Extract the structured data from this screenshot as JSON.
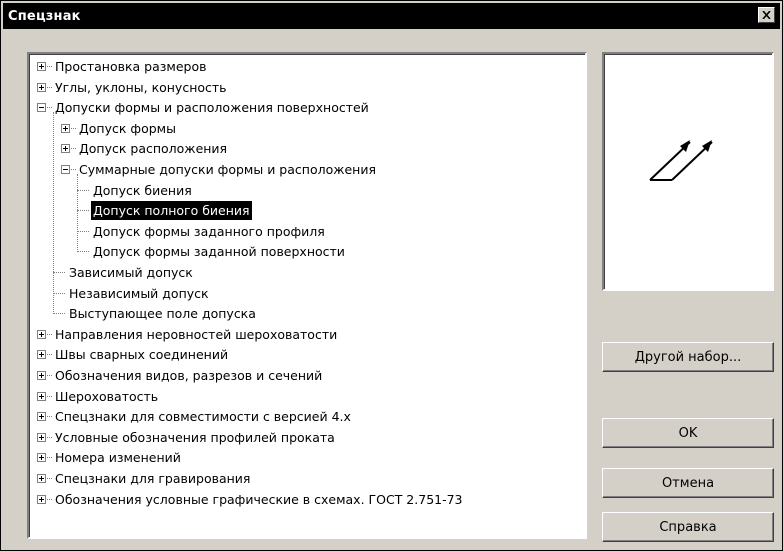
{
  "window": {
    "title": "Спецзнак",
    "close_icon": "close-icon"
  },
  "tree": {
    "items": [
      {
        "label": "Простановка размеров",
        "level": 0,
        "expander": "plus",
        "selected": false
      },
      {
        "label": "Углы, уклоны, конусность",
        "level": 0,
        "expander": "plus",
        "selected": false
      },
      {
        "label": "Допуски формы и расположения поверхностей",
        "level": 0,
        "expander": "minus",
        "selected": false
      },
      {
        "label": "Допуск формы",
        "level": 1,
        "expander": "plus",
        "selected": false
      },
      {
        "label": "Допуск расположения",
        "level": 1,
        "expander": "plus",
        "selected": false
      },
      {
        "label": "Суммарные допуски формы и расположения",
        "level": 1,
        "expander": "minus",
        "selected": false
      },
      {
        "label": "Допуск биения",
        "level": 2,
        "expander": "none",
        "selected": false
      },
      {
        "label": "Допуск полного биения",
        "level": 2,
        "expander": "none",
        "selected": true
      },
      {
        "label": "Допуск формы заданного профиля",
        "level": 2,
        "expander": "none",
        "selected": false
      },
      {
        "label": "Допуск формы заданной поверхности",
        "level": 2,
        "expander": "none",
        "selected": false
      },
      {
        "label": "Зависимый допуск",
        "level": 1,
        "expander": "none",
        "selected": false
      },
      {
        "label": "Независимый допуск",
        "level": 1,
        "expander": "none",
        "selected": false
      },
      {
        "label": "Выступающее поле допуска",
        "level": 1,
        "expander": "none",
        "selected": false
      },
      {
        "label": "Направления неровностей шероховатости",
        "level": 0,
        "expander": "plus",
        "selected": false
      },
      {
        "label": "Швы сварных соединений",
        "level": 0,
        "expander": "plus",
        "selected": false
      },
      {
        "label": "Обозначения видов, разрезов и сечений",
        "level": 0,
        "expander": "plus",
        "selected": false
      },
      {
        "label": "Шероховатость",
        "level": 0,
        "expander": "plus",
        "selected": false
      },
      {
        "label": "Спецзнаки для совместимости с версией 4.х",
        "level": 0,
        "expander": "plus",
        "selected": false
      },
      {
        "label": "Условные обозначения профилей проката",
        "level": 0,
        "expander": "plus",
        "selected": false
      },
      {
        "label": "Номера изменений",
        "level": 0,
        "expander": "plus",
        "selected": false
      },
      {
        "label": "Спецзнаки для гравирования",
        "level": 0,
        "expander": "plus",
        "selected": false
      },
      {
        "label": "Обозначения условные графические в схемах. ГОСТ 2.751-73",
        "level": 0,
        "expander": "plus",
        "selected": false
      }
    ]
  },
  "preview": {
    "icon": "total-runout-symbol-icon"
  },
  "buttons": {
    "other_set": "Другой набор...",
    "ok": "OK",
    "cancel": "Отмена",
    "help": "Справка"
  },
  "colors": {
    "titlebar": "#000000",
    "face": "#d4d0c8",
    "selection": "#000000"
  }
}
